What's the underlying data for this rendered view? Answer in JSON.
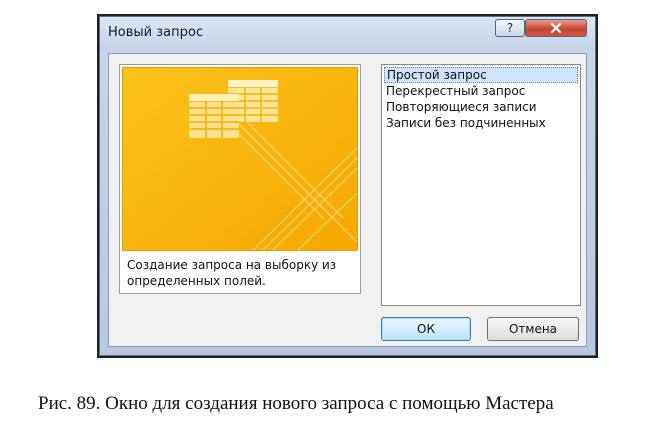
{
  "dialog": {
    "title": "Новый запрос",
    "help_label": "?",
    "description": "Создание запроса на выборку из\nопределенных полей.",
    "list_items": [
      "Простой запрос",
      "Перекрестный запрос",
      "Повторяющиеся записи",
      "Записи без подчиненных"
    ],
    "selected_item": "Простой запрос",
    "ok_label": "ОК",
    "cancel_label": "Отмена"
  },
  "caption": "Рис. 89. Окно для создания нового запроса с помощью Мастера",
  "colors": {
    "art_background": "#f7b500",
    "close_button": "#c6472f",
    "selection": "#cfe3fb"
  }
}
